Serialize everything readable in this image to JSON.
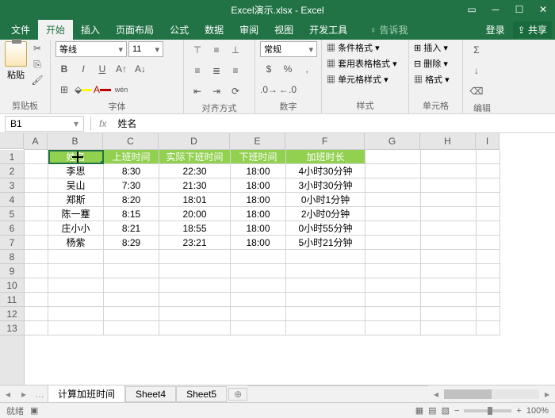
{
  "titlebar": {
    "title": "Excel演示.xlsx - Excel"
  },
  "tabs": {
    "file": "文件",
    "home": "开始",
    "insert": "插入",
    "layout": "页面布局",
    "formula": "公式",
    "data": "数据",
    "review": "审阅",
    "view": "视图",
    "dev": "开发工具",
    "tellme": "告诉我",
    "login": "登录",
    "share": "共享"
  },
  "ribbon": {
    "clipboard": {
      "label": "剪贴板",
      "paste": "粘贴"
    },
    "font": {
      "label": "字体",
      "name": "等线",
      "size": "11"
    },
    "align": {
      "label": "对齐方式"
    },
    "number": {
      "label": "数字",
      "format": "常规"
    },
    "styles": {
      "label": "样式",
      "condfmt": "条件格式",
      "tablefmt": "套用表格格式",
      "cellstyle": "单元格样式"
    },
    "cells": {
      "label": "单元格",
      "insert": "插入",
      "delete": "删除",
      "format": "格式"
    },
    "editing": {
      "label": "编辑"
    }
  },
  "namebox": "B1",
  "formula": "姓名",
  "columns": [
    "A",
    "B",
    "C",
    "D",
    "E",
    "F",
    "G",
    "H",
    "I"
  ],
  "rows": [
    "1",
    "2",
    "3",
    "4",
    "5",
    "6",
    "7",
    "8",
    "9",
    "10",
    "11",
    "12",
    "13"
  ],
  "chart_data": {
    "type": "table",
    "headers": [
      "姓名",
      "上班时间",
      "实际下班时间",
      "下班时间",
      "加班时长"
    ],
    "data": [
      [
        "李思",
        "8:30",
        "22:30",
        "18:00",
        "4小时30分钟"
      ],
      [
        "吴山",
        "7:30",
        "21:30",
        "18:00",
        "3小时30分钟"
      ],
      [
        "郑斯",
        "8:20",
        "18:01",
        "18:00",
        "0小时1分钟"
      ],
      [
        "陈一蹇",
        "8:15",
        "20:00",
        "18:00",
        "2小时0分钟"
      ],
      [
        "庄小小",
        "8:21",
        "18:55",
        "18:00",
        "0小时55分钟"
      ],
      [
        "杨紫",
        "8:29",
        "23:21",
        "18:00",
        "5小时21分钟"
      ]
    ]
  },
  "sheets": {
    "active": "计算加班时间",
    "s4": "Sheet4",
    "s5": "Sheet5"
  },
  "status": {
    "ready": "就绪",
    "zoom": "100%"
  }
}
